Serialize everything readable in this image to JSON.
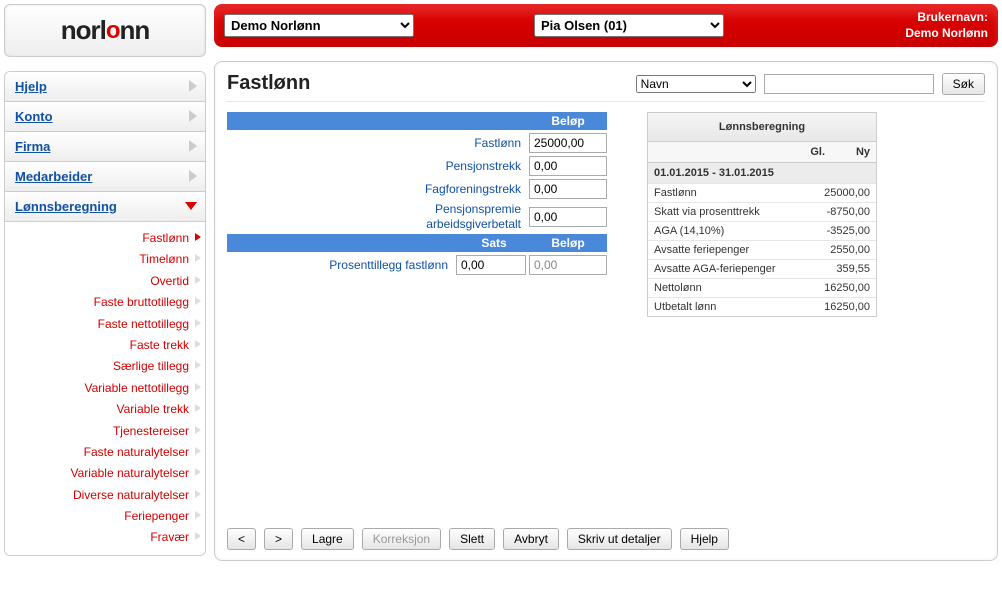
{
  "logo": "norlonn",
  "user": {
    "label": "Brukernavn:",
    "name": "Demo Norlønn"
  },
  "topSelect": {
    "company": "Demo Norlønn",
    "employee": "Pia Olsen (01)"
  },
  "mainMenu": [
    {
      "label": "Hjelp",
      "expanded": false
    },
    {
      "label": "Konto",
      "expanded": false
    },
    {
      "label": "Firma",
      "expanded": false
    },
    {
      "label": "Medarbeider",
      "expanded": false
    },
    {
      "label": "Lønnsberegning",
      "expanded": true
    }
  ],
  "subMenu": [
    {
      "label": "Fastlønn",
      "active": true
    },
    {
      "label": "Timelønn",
      "active": false
    },
    {
      "label": "Overtid",
      "active": false
    },
    {
      "label": "Faste bruttotillegg",
      "active": false
    },
    {
      "label": "Faste nettotillegg",
      "active": false
    },
    {
      "label": "Faste trekk",
      "active": false
    },
    {
      "label": "Særlige tillegg",
      "active": false
    },
    {
      "label": "Variable nettotillegg",
      "active": false
    },
    {
      "label": "Variable trekk",
      "active": false
    },
    {
      "label": "Tjenestereiser",
      "active": false
    },
    {
      "label": "Faste naturalytelser",
      "active": false
    },
    {
      "label": "Variable naturalytelser",
      "active": false
    },
    {
      "label": "Diverse naturalytelser",
      "active": false
    },
    {
      "label": "Feriepenger",
      "active": false
    },
    {
      "label": "Fravær",
      "active": false
    }
  ],
  "panel": {
    "title": "Fastlønn",
    "searchSelect": "Navn",
    "searchValue": "",
    "searchBtn": "Søk"
  },
  "gridHeaders": {
    "sats": "Sats",
    "belop": "Beløp"
  },
  "fields1": {
    "fastlonn": {
      "label": "Fastlønn",
      "value": "25000,00"
    },
    "pensjonstrekk": {
      "label": "Pensjonstrekk",
      "value": "0,00"
    },
    "fagforeningstrekk": {
      "label": "Fagforeningstrekk",
      "value": "0,00"
    },
    "pensjonspremie": {
      "label1": "Pensjonspremie",
      "label2": "arbeidsgiverbetalt",
      "value": "0,00"
    }
  },
  "fields2": {
    "prosenttillegg": {
      "label": "Prosenttillegg fastlønn",
      "sats": "0,00",
      "belop": "0,00"
    }
  },
  "calc": {
    "title": "Lønnsberegning",
    "col_gl": "Gl.",
    "col_ny": "Ny",
    "period": "01.01.2015 - 31.01.2015",
    "rows": [
      {
        "k": "Fastlønn",
        "v": "25000,00"
      },
      {
        "k": "Skatt via prosenttrekk",
        "v": "-8750,00"
      },
      {
        "k": "AGA (14,10%)",
        "v": "-3525,00"
      },
      {
        "k": "Avsatte feriepenger",
        "v": "2550,00"
      },
      {
        "k": "Avsatte AGA-feriepenger",
        "v": "359,55"
      },
      {
        "k": "Nettolønn",
        "v": "16250,00"
      },
      {
        "k": "Utbetalt lønn",
        "v": "16250,00"
      }
    ]
  },
  "footer": {
    "prev": "<",
    "next": ">",
    "lagre": "Lagre",
    "korreksjon": "Korreksjon",
    "slett": "Slett",
    "avbryt": "Avbryt",
    "skrivut": "Skriv ut detaljer",
    "hjelp": "Hjelp"
  }
}
